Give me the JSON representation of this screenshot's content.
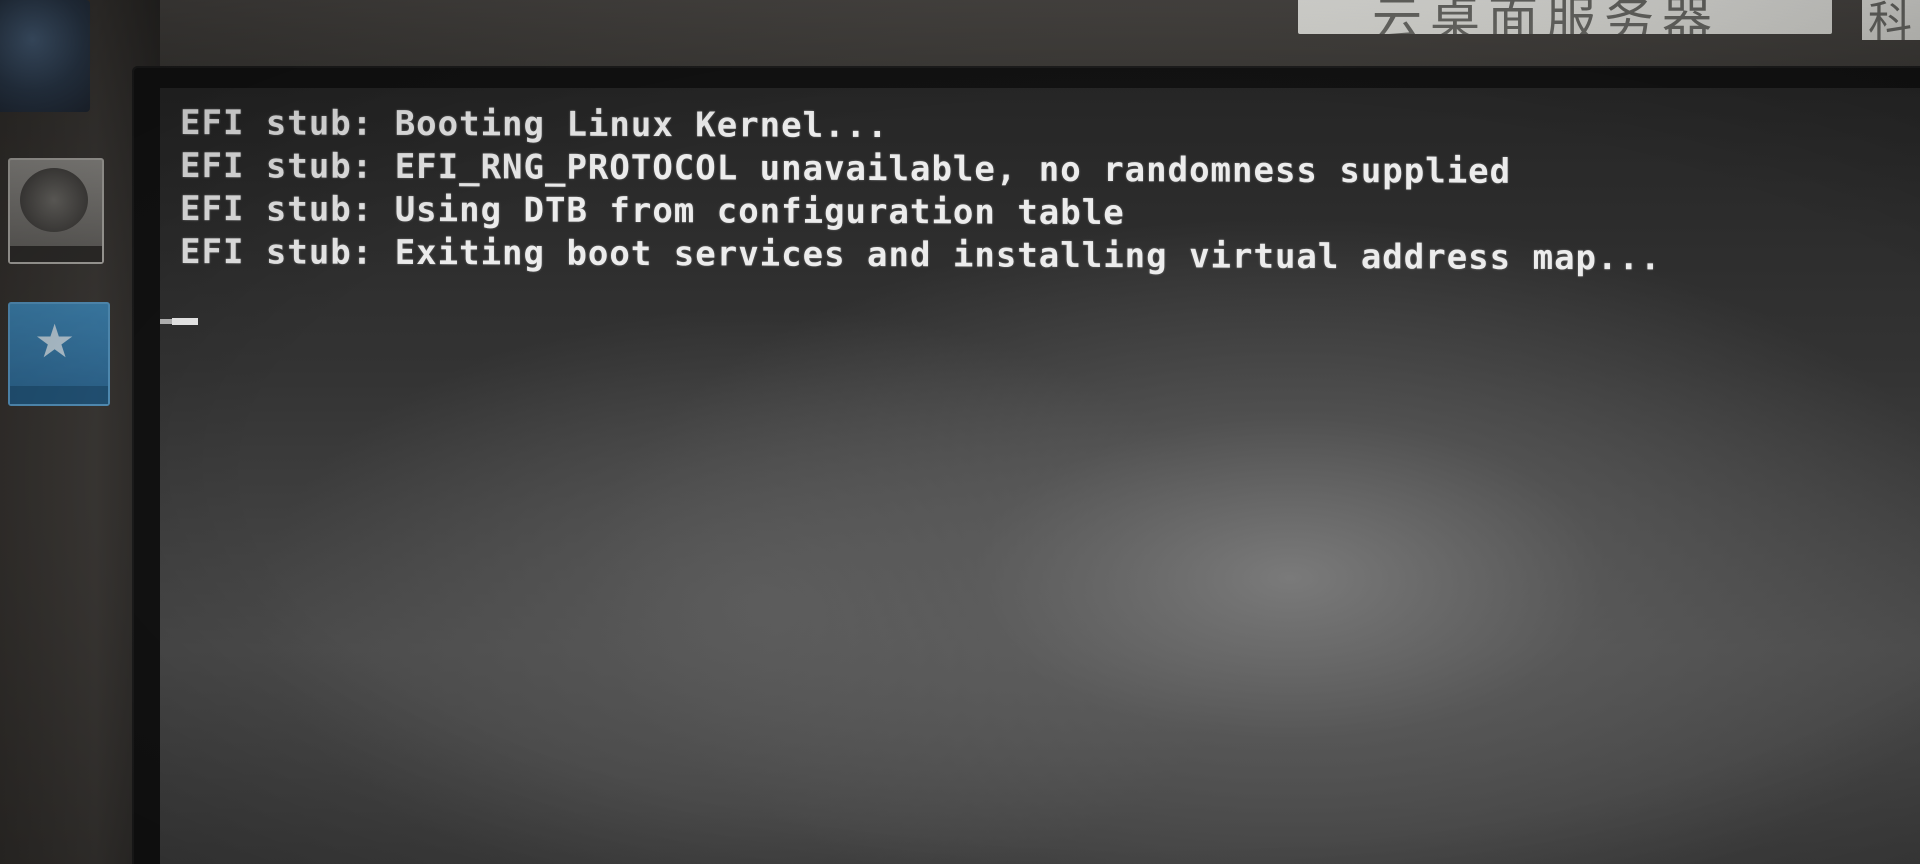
{
  "sign": {
    "main_text": "云桌面服务器",
    "side_text": "科"
  },
  "console": {
    "lines": [
      "EFI stub: Booting Linux Kernel...",
      "EFI stub: EFI_RNG_PROTOCOL unavailable, no randomness supplied",
      "EFI stub: Using DTB from configuration table",
      "EFI stub: Exiting boot services and installing virtual address map..."
    ]
  },
  "colors": {
    "console_text": "#ececec",
    "screen_dark": "#262626",
    "screen_glare": "#7a7a7a",
    "bezel": "#121212"
  },
  "icons": {
    "cursor": "blinking-underscore-cursor",
    "sticker_top": "windows-logo-sticker",
    "sticker_middle": "silver-certification-sticker",
    "sticker_bottom": "energy-star-sticker"
  }
}
